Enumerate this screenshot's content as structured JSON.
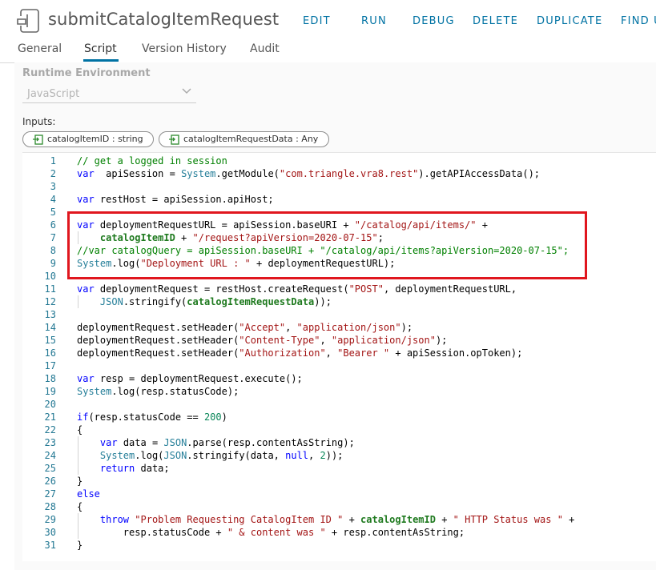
{
  "header": {
    "title": "submitCatalogItemRequest",
    "actions": [
      "EDIT",
      "RUN",
      "DEBUG",
      "DELETE",
      "DUPLICATE",
      "FIND U"
    ]
  },
  "tabs": [
    "General",
    "Script",
    "Version History",
    "Audit"
  ],
  "active_tab": "Script",
  "runtime": {
    "label": "Runtime Environment",
    "value": "JavaScript"
  },
  "inputs": {
    "label": "Inputs:",
    "items": [
      "catalogItemID : string",
      "catalogItemRequestData : Any"
    ]
  },
  "colors": {
    "accent": "#0072a3",
    "highlight_border": "#e0161e",
    "keyword": "#0000ff",
    "string": "#a31515",
    "comment": "#008000"
  },
  "code": {
    "line_numbers": [
      "1",
      "2",
      "3",
      "4",
      "5",
      "6",
      "7",
      "8",
      "9",
      "10",
      "11",
      "12",
      "13",
      "14",
      "15",
      "16",
      "17",
      "18",
      "19",
      "20",
      "21",
      "22",
      "23",
      "24",
      "25",
      "26",
      "27",
      "28",
      "29",
      "30",
      "31"
    ],
    "lines": [
      [
        [
          "cm",
          "// get a logged in session"
        ]
      ],
      [
        [
          "kw",
          "var"
        ],
        [
          "",
          "  apiSession = "
        ],
        [
          "ty",
          "System"
        ],
        [
          "",
          ".getModule("
        ],
        [
          "str",
          "\"com.triangle.vra8.rest\""
        ],
        [
          "",
          ").getAPIAccessData();"
        ]
      ],
      [],
      [
        [
          "kw",
          "var"
        ],
        [
          "",
          " restHost = apiSession.apiHost;"
        ]
      ],
      [],
      [
        [
          "kw",
          "var"
        ],
        [
          "",
          " deploymentRequestURL = apiSession.baseURI + "
        ],
        [
          "str",
          "\"/catalog/api/items/\""
        ],
        [
          "",
          " +"
        ]
      ],
      [
        [
          "",
          "    "
        ],
        [
          "bold",
          "catalogItemID"
        ],
        [
          "",
          " + "
        ],
        [
          "str",
          "\"/request?apiVersion=2020-07-15\""
        ],
        [
          "",
          ";"
        ]
      ],
      [
        [
          "cm",
          "//var catalogQuery = apiSession.baseURI + \"/catalog/api/items?apiVersion=2020-07-15\";"
        ]
      ],
      [
        [
          "ty",
          "System"
        ],
        [
          "",
          ".log("
        ],
        [
          "str",
          "\"Deployment URL : \""
        ],
        [
          "",
          " + deploymentRequestURL);"
        ]
      ],
      [],
      [
        [
          "kw",
          "var"
        ],
        [
          "",
          " deploymentRequest = restHost.createRequest("
        ],
        [
          "str",
          "\"POST\""
        ],
        [
          "",
          ", deploymentRequestURL,"
        ]
      ],
      [
        [
          "",
          "    "
        ],
        [
          "ty",
          "JSON"
        ],
        [
          "",
          ".stringify("
        ],
        [
          "bold",
          "catalogItemRequestData"
        ],
        [
          "",
          "));"
        ]
      ],
      [],
      [
        [
          "",
          "deploymentRequest.setHeader("
        ],
        [
          "str",
          "\"Accept\""
        ],
        [
          "",
          ", "
        ],
        [
          "str",
          "\"application/json\""
        ],
        [
          "",
          ");"
        ]
      ],
      [
        [
          "",
          "deploymentRequest.setHeader("
        ],
        [
          "str",
          "\"Content-Type\""
        ],
        [
          "",
          ", "
        ],
        [
          "str",
          "\"application/json\""
        ],
        [
          "",
          ");"
        ]
      ],
      [
        [
          "",
          "deploymentRequest.setHeader("
        ],
        [
          "str",
          "\"Authorization\""
        ],
        [
          "",
          ", "
        ],
        [
          "str",
          "\"Bearer \""
        ],
        [
          "",
          " + apiSession.opToken);"
        ]
      ],
      [],
      [
        [
          "kw",
          "var"
        ],
        [
          "",
          " resp = deploymentRequest.execute();"
        ]
      ],
      [
        [
          "ty",
          "System"
        ],
        [
          "",
          ".log(resp.statusCode);"
        ]
      ],
      [],
      [
        [
          "kw",
          "if"
        ],
        [
          "",
          "(resp.statusCode == "
        ],
        [
          "num",
          "200"
        ],
        [
          "",
          ")"
        ]
      ],
      [
        [
          "",
          "{"
        ]
      ],
      [
        [
          "",
          "    "
        ],
        [
          "kw",
          "var"
        ],
        [
          "",
          " data = "
        ],
        [
          "ty",
          "JSON"
        ],
        [
          "",
          ".parse(resp.contentAsString);"
        ]
      ],
      [
        [
          "",
          "    "
        ],
        [
          "ty",
          "System"
        ],
        [
          "",
          ".log("
        ],
        [
          "ty",
          "JSON"
        ],
        [
          "",
          ".stringify(data, "
        ],
        [
          "kw",
          "null"
        ],
        [
          "",
          ", "
        ],
        [
          "num",
          "2"
        ],
        [
          "",
          "));"
        ]
      ],
      [
        [
          "",
          "    "
        ],
        [
          "kw",
          "return"
        ],
        [
          "",
          " data;"
        ]
      ],
      [
        [
          "",
          "}"
        ]
      ],
      [
        [
          "kw",
          "else"
        ]
      ],
      [
        [
          "",
          "{"
        ]
      ],
      [
        [
          "",
          "    "
        ],
        [
          "kw",
          "throw"
        ],
        [
          "",
          " "
        ],
        [
          "str",
          "\"Problem Requesting CatalogItem ID \""
        ],
        [
          "",
          " + "
        ],
        [
          "bold",
          "catalogItemID"
        ],
        [
          "",
          " + "
        ],
        [
          "str",
          "\" HTTP Status was \""
        ],
        [
          "",
          " +"
        ]
      ],
      [
        [
          "",
          "        resp.statusCode + "
        ],
        [
          "str",
          "\" & content was \""
        ],
        [
          "",
          " + resp.contentAsString;"
        ]
      ],
      [
        [
          "",
          "}"
        ]
      ]
    ]
  }
}
